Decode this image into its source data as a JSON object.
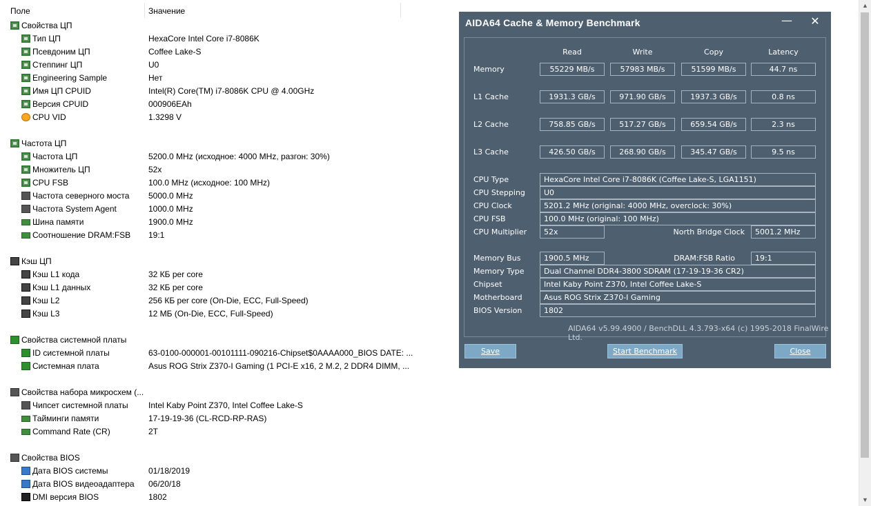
{
  "list": {
    "header_field": "Поле",
    "header_value": "Значение",
    "groups": [
      {
        "title": "Свойства ЦП",
        "icon": "cpu-icon",
        "rows": [
          {
            "f": "Тип ЦП",
            "v": "HexaCore Intel Core i7-8086K",
            "icon": "cpu-icon"
          },
          {
            "f": "Псевдоним ЦП",
            "v": "Coffee Lake-S",
            "icon": "cpu-icon"
          },
          {
            "f": "Степпинг ЦП",
            "v": "U0",
            "icon": "cpu-icon"
          },
          {
            "f": "Engineering Sample",
            "v": "Нет",
            "icon": "cpu-icon"
          },
          {
            "f": "Имя ЦП CPUID",
            "v": "Intel(R) Core(TM) i7-8086K CPU @ 4.00GHz",
            "icon": "cpu-icon"
          },
          {
            "f": "Версия CPUID",
            "v": "000906EAh",
            "icon": "cpu-icon"
          },
          {
            "f": "CPU VID",
            "v": "1.3298 V",
            "icon": "voltage-icon"
          }
        ]
      },
      {
        "title": "Частота ЦП",
        "icon": "cpu-icon",
        "rows": [
          {
            "f": "Частота ЦП",
            "v": "5200.0 MHz  (исходное: 4000 MHz, разгон: 30%)",
            "icon": "cpu-icon"
          },
          {
            "f": "Множитель ЦП",
            "v": "52x",
            "icon": "cpu-icon"
          },
          {
            "f": "CPU FSB",
            "v": "100.0 MHz  (исходное: 100 MHz)",
            "icon": "cpu-icon"
          },
          {
            "f": "Частота северного моста",
            "v": "5000.0 MHz",
            "icon": "chip-icon"
          },
          {
            "f": "Частота System Agent",
            "v": "1000.0 MHz",
            "icon": "chip-icon"
          },
          {
            "f": "Шина памяти",
            "v": "1900.0 MHz",
            "icon": "memory-icon"
          },
          {
            "f": "Соотношение DRAM:FSB",
            "v": "19:1",
            "icon": "memory-icon"
          }
        ]
      },
      {
        "title": "Кэш ЦП",
        "icon": "cache-icon",
        "rows": [
          {
            "f": "Кэш L1 кода",
            "v": "32 КБ per core",
            "icon": "cache-icon"
          },
          {
            "f": "Кэш L1 данных",
            "v": "32 КБ per core",
            "icon": "cache-icon"
          },
          {
            "f": "Кэш L2",
            "v": "256 КБ per core  (On-Die, ECC, Full-Speed)",
            "icon": "cache-icon"
          },
          {
            "f": "Кэш L3",
            "v": "12 МБ  (On-Die, ECC, Full-Speed)",
            "icon": "cache-icon"
          }
        ]
      },
      {
        "title": "Свойства системной платы",
        "icon": "motherboard-icon",
        "rows": [
          {
            "f": "ID системной платы",
            "v": "63-0100-000001-00101111-090216-Chipset$0AAAA000_BIOS DATE: ...",
            "icon": "motherboard-icon"
          },
          {
            "f": "Системная плата",
            "v": "Asus ROG Strix Z370-I Gaming  (1 PCI-E x16, 2 M.2, 2 DDR4 DIMM, ...",
            "icon": "motherboard-icon"
          }
        ]
      },
      {
        "title": "Свойства набора микросхем (...",
        "icon": "chip-icon",
        "rows": [
          {
            "f": "Чипсет системной платы",
            "v": "Intel Kaby Point Z370, Intel Coffee Lake-S",
            "icon": "chip-icon"
          },
          {
            "f": "Тайминги памяти",
            "v": "17-19-19-36  (CL-RCD-RP-RAS)",
            "icon": "memory-icon"
          },
          {
            "f": "Command Rate (CR)",
            "v": "2T",
            "icon": "memory-icon"
          }
        ]
      },
      {
        "title": "Свойства BIOS",
        "icon": "chip-icon",
        "rows": [
          {
            "f": "Дата BIOS системы",
            "v": "01/18/2019",
            "icon": "monitor-icon"
          },
          {
            "f": "Дата BIOS видеоадаптера",
            "v": "06/20/18",
            "icon": "monitor-icon"
          },
          {
            "f": "DMI версия BIOS",
            "v": "1802",
            "icon": "dmi-icon"
          }
        ]
      }
    ]
  },
  "dialog": {
    "title": "AIDA64 Cache & Memory Benchmark",
    "minimize_glyph": "—",
    "close_glyph": "✕",
    "columns": [
      "Read",
      "Write",
      "Copy",
      "Latency"
    ],
    "bench_rows": [
      {
        "label": "Memory",
        "values": [
          "55229 MB/s",
          "57983 MB/s",
          "51599 MB/s",
          "44.7 ns"
        ]
      },
      {
        "label": "L1 Cache",
        "values": [
          "1931.3 GB/s",
          "971.90 GB/s",
          "1937.3 GB/s",
          "0.8 ns"
        ]
      },
      {
        "label": "L2 Cache",
        "values": [
          "758.85 GB/s",
          "517.27 GB/s",
          "659.54 GB/s",
          "2.3 ns"
        ]
      },
      {
        "label": "L3 Cache",
        "values": [
          "426.50 GB/s",
          "268.90 GB/s",
          "345.47 GB/s",
          "9.5 ns"
        ]
      }
    ],
    "info": {
      "cpu_type_label": "CPU Type",
      "cpu_type": "HexaCore Intel Core i7-8086K  (Coffee Lake-S, LGA1151)",
      "cpu_stepping_label": "CPU Stepping",
      "cpu_stepping": "U0",
      "cpu_clock_label": "CPU Clock",
      "cpu_clock": "5201.2 MHz  (original: 4000 MHz, overclock: 30%)",
      "cpu_fsb_label": "CPU FSB",
      "cpu_fsb": "100.0 MHz  (original: 100 MHz)",
      "cpu_multiplier_label": "CPU Multiplier",
      "cpu_multiplier": "52x",
      "nb_clock_label": "North Bridge Clock",
      "nb_clock": "5001.2 MHz",
      "memory_bus_label": "Memory Bus",
      "memory_bus": "1900.5 MHz",
      "dram_fsb_label": "DRAM:FSB Ratio",
      "dram_fsb": "19:1",
      "memory_type_label": "Memory Type",
      "memory_type": "Dual Channel DDR4-3800 SDRAM  (17-19-19-36 CR2)",
      "chipset_label": "Chipset",
      "chipset": "Intel Kaby Point Z370, Intel Coffee Lake-S",
      "motherboard_label": "Motherboard",
      "motherboard": "Asus ROG Strix Z370-I Gaming",
      "bios_label": "BIOS Version",
      "bios": "1802"
    },
    "footer": "AIDA64 v5.99.4900 / BenchDLL 4.3.793-x64  (c) 1995-2018 FinalWire Ltd.",
    "buttons": {
      "save": "Save",
      "start": "Start Benchmark",
      "close": "Close"
    }
  }
}
